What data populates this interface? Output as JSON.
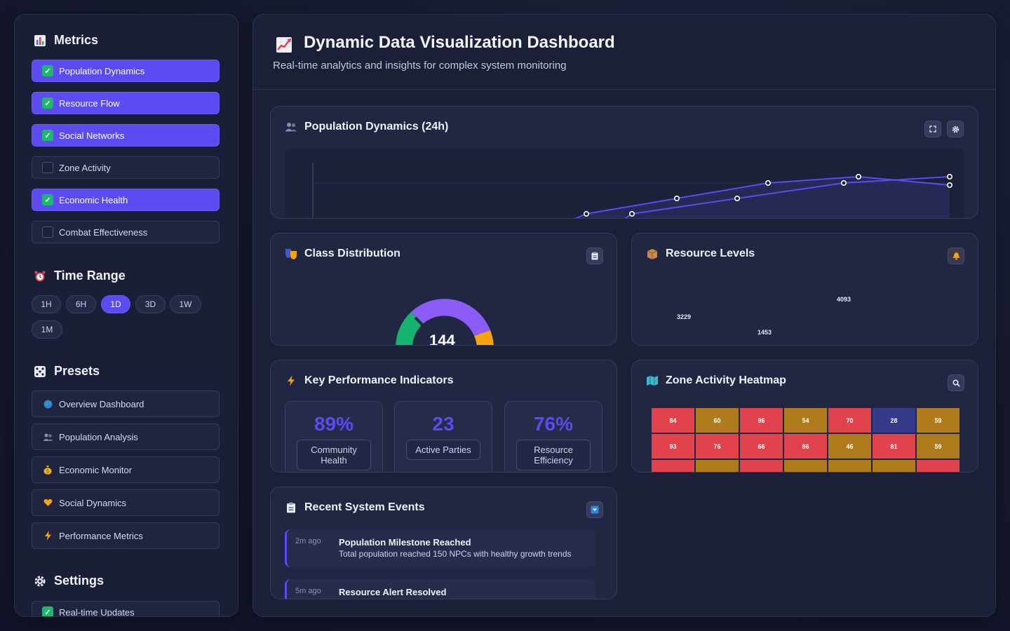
{
  "sidebar": {
    "metrics": {
      "title": "Metrics",
      "icon": "bar-chart-icon",
      "items": [
        {
          "label": "Population Dynamics",
          "checked": true
        },
        {
          "label": "Resource Flow",
          "checked": true
        },
        {
          "label": "Social Networks",
          "checked": true
        },
        {
          "label": "Zone Activity",
          "checked": false
        },
        {
          "label": "Economic Health",
          "checked": true
        },
        {
          "label": "Combat Effectiveness",
          "checked": false
        }
      ]
    },
    "time_range": {
      "title": "Time Range",
      "icon": "alarm-clock-icon",
      "options": [
        "1H",
        "6H",
        "1D",
        "3D",
        "1W",
        "1M"
      ],
      "selected": "1D"
    },
    "presets": {
      "title": "Presets",
      "icon": "dice-icon",
      "items": [
        {
          "label": "Overview Dashboard",
          "icon": "globe-icon"
        },
        {
          "label": "Population Analysis",
          "icon": "people-icon"
        },
        {
          "label": "Economic Monitor",
          "icon": "money-bag-icon"
        },
        {
          "label": "Social Dynamics",
          "icon": "heart-icon"
        },
        {
          "label": "Performance Metrics",
          "icon": "lightning-icon"
        }
      ]
    },
    "settings": {
      "title": "Settings",
      "icon": "gear-icon",
      "items": [
        {
          "label": "Real-time Updates",
          "checked": true
        }
      ]
    }
  },
  "header": {
    "title": "Dynamic Data Visualization Dashboard",
    "subtitle": "Real-time analytics and insights for complex system monitoring",
    "icon": "chart-increasing-icon"
  },
  "population_card": {
    "title": "Population Dynamics (24h)",
    "icon": "people-icon",
    "tools": [
      "expand-icon",
      "gear-icon"
    ]
  },
  "class_card": {
    "title": "Class Distribution",
    "icon": "masks-icon",
    "tool": "clipboard-icon",
    "center_value": "144"
  },
  "resource_card": {
    "title": "Resource Levels",
    "icon": "package-icon",
    "tool": "bell-icon",
    "labels": [
      "3229",
      "1453",
      "4093"
    ]
  },
  "kpi_card": {
    "title": "Key Performance Indicators",
    "icon": "lightning-icon",
    "items": [
      {
        "value": "89%",
        "label": "Community Health"
      },
      {
        "value": "23",
        "label": "Active Parties"
      },
      {
        "value": "76%",
        "label": "Resource Efficiency"
      }
    ]
  },
  "heatmap_card": {
    "title": "Zone Activity Heatmap",
    "icon": "map-icon",
    "tool": "search-icon",
    "rows": [
      [
        84,
        60,
        96,
        54,
        70,
        28,
        59
      ],
      [
        93,
        76,
        66,
        86,
        46,
        81,
        59
      ]
    ],
    "colors": {
      "high": "#e0434b",
      "mid": "#b07b1d",
      "low": "#35398a"
    }
  },
  "events_card": {
    "title": "Recent System Events",
    "icon": "clipboard-icon",
    "tool": "dropdown-icon",
    "events": [
      {
        "time": "2m ago",
        "title": "Population Milestone Reached",
        "desc": "Total population reached 150 NPCs with healthy growth trends"
      },
      {
        "time": "5m ago",
        "title": "Resource Alert Resolved",
        "desc": ""
      }
    ]
  },
  "colors": {
    "accent": "#5b4bf0",
    "check": "#1fb86a",
    "orange": "#f5a30e",
    "green": "#14b370",
    "purple": "#8b5cf6"
  }
}
